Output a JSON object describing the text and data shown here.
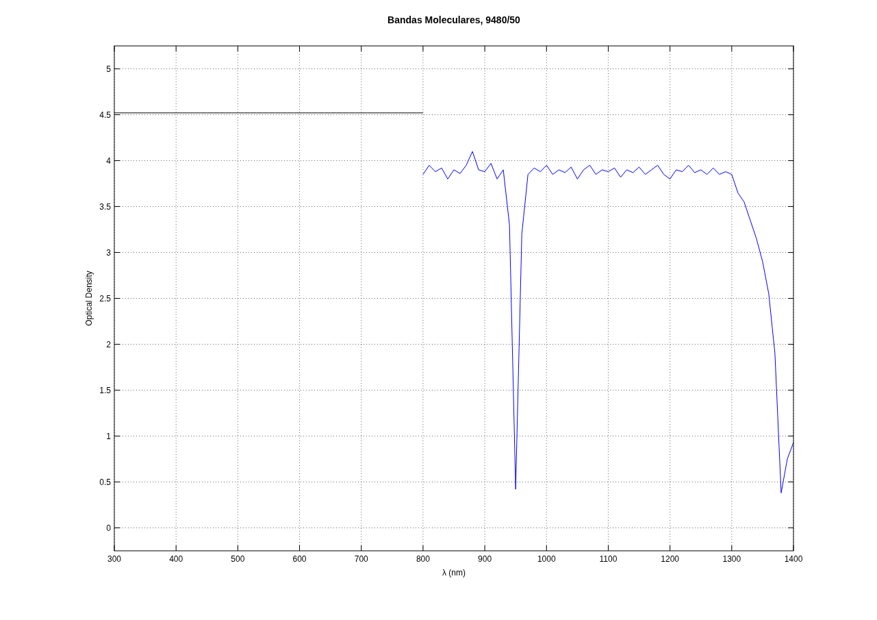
{
  "figure": {
    "chart_data": {
      "type": "line",
      "title": "Bandas Moleculares, 9480/50",
      "xlabel": "λ (nm)",
      "ylabel": "Optical Density",
      "x": [
        300,
        310,
        320,
        330,
        340,
        350,
        360,
        370,
        380,
        390,
        400,
        410,
        420,
        430,
        440,
        450,
        460,
        470,
        480,
        490,
        500,
        510,
        520,
        530,
        540,
        550,
        560,
        570,
        580,
        590,
        600,
        610,
        620,
        630,
        640,
        650,
        660,
        670,
        680,
        690,
        700,
        710,
        720,
        730,
        740,
        750,
        760,
        770,
        780,
        790,
        800,
        810,
        820,
        830,
        840,
        850,
        860,
        870,
        880,
        890,
        900,
        910,
        920,
        930,
        940,
        950,
        960,
        970,
        980,
        990,
        1000,
        1010,
        1020,
        1030,
        1040,
        1050,
        1060,
        1070,
        1080,
        1090,
        1100,
        1110,
        1120,
        1130,
        1140,
        1150,
        1160,
        1170,
        1180,
        1190,
        1200,
        1210,
        1220,
        1230,
        1240,
        1250,
        1260,
        1270,
        1280,
        1290,
        1300,
        1310,
        1320,
        1330,
        1340,
        1350,
        1360,
        1370,
        1380,
        1390,
        1400
      ],
      "series": [
        {
          "color": "#000000",
          "values": [
            4.52,
            4.52,
            4.52,
            4.52,
            4.52,
            4.52,
            4.52,
            4.52,
            4.52,
            4.52,
            4.52,
            4.52,
            4.52,
            4.52,
            4.52,
            4.52,
            4.52,
            4.52,
            4.52,
            4.52,
            4.52,
            4.52,
            4.52,
            4.52,
            4.52,
            4.52,
            4.52,
            4.52,
            4.52,
            4.52,
            4.52,
            4.52,
            4.52,
            4.52,
            4.52,
            4.52,
            4.52,
            4.52,
            4.52,
            4.52,
            4.52,
            4.52,
            4.52,
            4.52,
            4.52,
            4.52,
            4.52,
            4.52,
            4.52,
            4.52,
            4.52,
            null,
            null,
            null,
            null,
            null,
            null,
            null,
            null,
            null,
            null,
            null,
            null,
            null,
            null,
            null,
            null,
            null,
            null,
            null,
            null,
            null,
            null,
            null,
            null,
            null,
            null,
            null,
            null,
            null,
            null,
            null,
            null,
            null,
            null,
            null,
            null,
            null,
            null,
            null,
            null,
            null,
            null,
            null,
            null,
            null,
            null,
            null,
            null,
            null,
            null,
            null,
            null,
            null,
            null,
            null,
            null,
            null,
            null,
            null,
            null
          ]
        },
        {
          "color": "#0000ff",
          "values": [
            null,
            null,
            null,
            null,
            null,
            null,
            null,
            null,
            null,
            null,
            null,
            null,
            null,
            null,
            null,
            null,
            null,
            null,
            null,
            null,
            null,
            null,
            null,
            null,
            null,
            null,
            null,
            null,
            null,
            null,
            null,
            null,
            null,
            null,
            null,
            null,
            null,
            null,
            null,
            null,
            null,
            null,
            null,
            null,
            null,
            null,
            null,
            null,
            null,
            null,
            3.85,
            3.95,
            3.88,
            3.92,
            3.8,
            3.9,
            3.86,
            3.95,
            4.1,
            3.9,
            3.88,
            3.97,
            3.8,
            3.9,
            3.3,
            0.42,
            3.2,
            3.85,
            3.92,
            3.88,
            3.95,
            3.85,
            3.9,
            3.87,
            3.93,
            3.8,
            3.9,
            3.95,
            3.85,
            3.9,
            3.88,
            3.92,
            3.82,
            3.9,
            3.87,
            3.93,
            3.85,
            3.9,
            3.95,
            3.85,
            3.8,
            3.9,
            3.88,
            3.95,
            3.87,
            3.9,
            3.85,
            3.92,
            3.85,
            3.88,
            3.85,
            3.65,
            3.55,
            3.35,
            3.15,
            2.9,
            2.55,
            1.9,
            0.38,
            0.75,
            0.93
          ]
        }
      ],
      "xlim": [
        300,
        1400
      ],
      "ylim": [
        -0.25,
        5.25
      ],
      "xticks": [
        300,
        400,
        500,
        600,
        700,
        800,
        900,
        1000,
        1100,
        1200,
        1300,
        1400
      ],
      "yticks": [
        0,
        0.5,
        1,
        1.5,
        2,
        2.5,
        3,
        3.5,
        4,
        4.5,
        5
      ]
    }
  }
}
